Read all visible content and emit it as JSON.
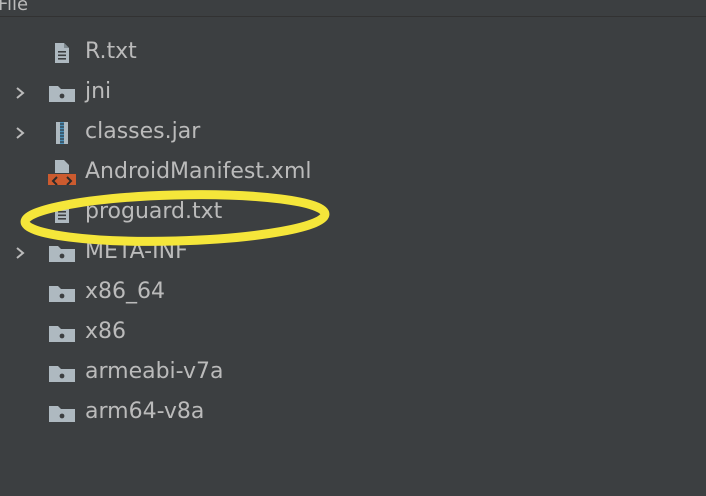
{
  "header": {
    "title": "File"
  },
  "tree": {
    "items": [
      {
        "label": "R.txt",
        "icon": "text-file-icon",
        "expandable": false
      },
      {
        "label": "jni",
        "icon": "folder-icon",
        "expandable": true
      },
      {
        "label": "classes.jar",
        "icon": "jar-file-icon",
        "expandable": true
      },
      {
        "label": "AndroidManifest.xml",
        "icon": "xml-file-icon",
        "expandable": false
      },
      {
        "label": "proguard.txt",
        "icon": "text-file-icon",
        "expandable": false
      },
      {
        "label": "META-INF",
        "icon": "folder-icon",
        "expandable": true
      },
      {
        "label": "x86_64",
        "icon": "folder-icon",
        "expandable": false
      },
      {
        "label": "x86",
        "icon": "folder-icon",
        "expandable": false
      },
      {
        "label": "armeabi-v7a",
        "icon": "folder-icon",
        "expandable": false
      },
      {
        "label": "arm64-v8a",
        "icon": "folder-icon",
        "expandable": false
      }
    ]
  },
  "colors": {
    "background": "#3c3f41",
    "text": "#bbbbbb",
    "folder": "#aeb9c0",
    "xml": "#cc5b2f",
    "highlight": "#f5e63a"
  }
}
